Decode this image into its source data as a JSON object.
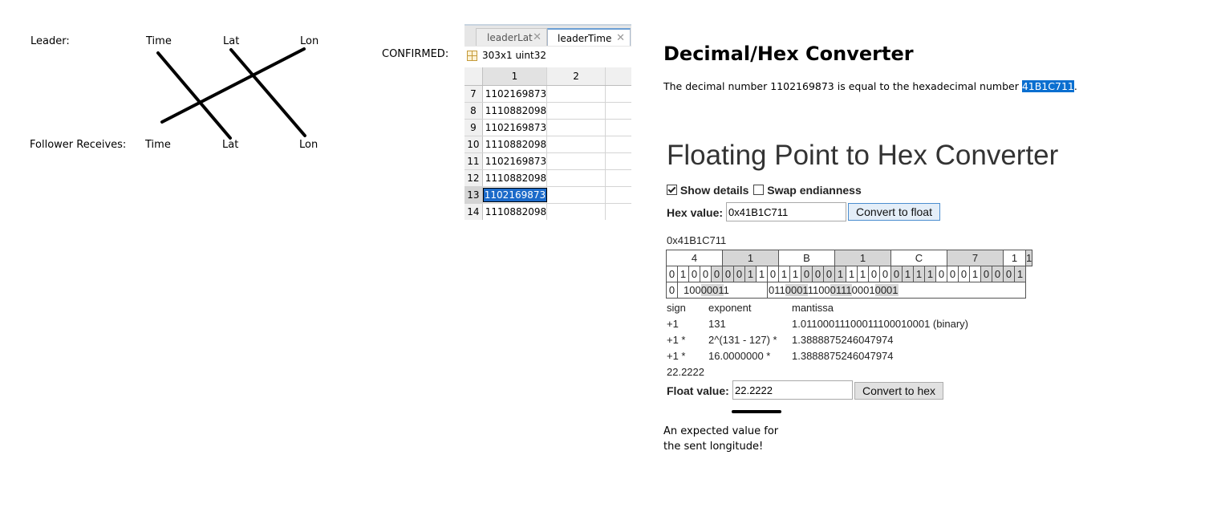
{
  "diagram": {
    "leader_label": "Leader:",
    "follower_label": "Follower Receives:",
    "leader_fields": [
      "Time",
      "Lat",
      "Lon"
    ],
    "follower_fields": [
      "Time",
      "Lat",
      "Lon"
    ],
    "confirmed_label": "CONFIRMED:"
  },
  "variable_editor": {
    "tabs": [
      "leaderLat",
      "leaderTime"
    ],
    "active_tab": "leaderTime",
    "info": "303x1 uint32",
    "columns": [
      "1",
      "2"
    ],
    "rows": [
      {
        "index": "7",
        "value": "1102169873"
      },
      {
        "index": "8",
        "value": "1110882098"
      },
      {
        "index": "9",
        "value": "1102169873"
      },
      {
        "index": "10",
        "value": "1110882098"
      },
      {
        "index": "11",
        "value": "1102169873"
      },
      {
        "index": "12",
        "value": "1110882098"
      },
      {
        "index": "13",
        "value": "1102169873"
      },
      {
        "index": "14",
        "value": "1110882098"
      }
    ],
    "selected_row": "13"
  },
  "decimal_hex": {
    "title": "Decimal/Hex Converter",
    "sentence_prefix": "The decimal number 1102169873 is equal to the hexadecimal number ",
    "hex_result": "41B1C711",
    "sentence_suffix": "."
  },
  "float_converter": {
    "title": "Floating Point to Hex Converter",
    "show_details_label": "Show details",
    "show_details_checked": true,
    "swap_endianness_label": "Swap endianness",
    "swap_endianness_checked": false,
    "hex_label": "Hex value:",
    "hex_value": "0x41B1C711",
    "convert_to_float": "Convert to float",
    "hex_echo": "0x41B1C711",
    "nibbles": [
      "4",
      "1",
      "B",
      "1",
      "C",
      "7",
      "1",
      "1"
    ],
    "bits": [
      "0",
      "1",
      "0",
      "0",
      "0",
      "0",
      "0",
      "1",
      "1",
      "0",
      "1",
      "1",
      "0",
      "0",
      "0",
      "1",
      "1",
      "1",
      "0",
      "0",
      "0",
      "1",
      "1",
      "1",
      "0",
      "0",
      "0",
      "1",
      "0",
      "0",
      "0",
      "1"
    ],
    "sign_bit": "0",
    "exponent_bits": [
      "100",
      "0001",
      "1"
    ],
    "mantissa_bits": [
      "011",
      "0001",
      "1100",
      "0111",
      "0001",
      "0001"
    ],
    "breakdown": {
      "headers": [
        "sign",
        "exponent",
        "mantissa"
      ],
      "row1": [
        "+1",
        "131",
        "1.01100011100011100010001 (binary)"
      ],
      "row2": [
        "+1 *",
        "2^(131 - 127) *",
        "1.3888875246047974"
      ],
      "row3": [
        "+1 *",
        "16.0000000 *",
        "1.3888875246047974"
      ],
      "result": "22.2222"
    },
    "float_label": "Float value:",
    "float_value": "22.2222",
    "convert_to_hex": "Convert to hex"
  },
  "note": "An expected value for the sent longitude!"
}
